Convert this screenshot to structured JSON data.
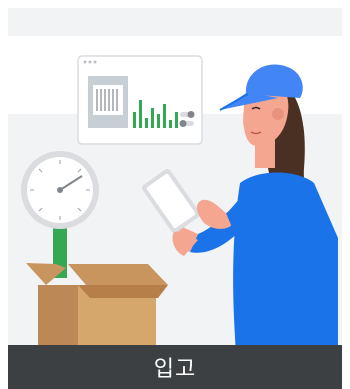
{
  "card": {
    "caption": "입고"
  },
  "illustration": {
    "icons": [
      "dashboard-window",
      "bar-chart",
      "toggle-switch",
      "scale",
      "cardboard-box",
      "tablet",
      "worker-with-cap"
    ]
  },
  "colors": {
    "caption_bar": "#3c4043",
    "cap_blue": "#4285f4",
    "shirt_blue": "#1a73e8",
    "chart_green": "#34a853",
    "box_brown": "#c8955f",
    "wall_gray": "#f1f3f4"
  }
}
